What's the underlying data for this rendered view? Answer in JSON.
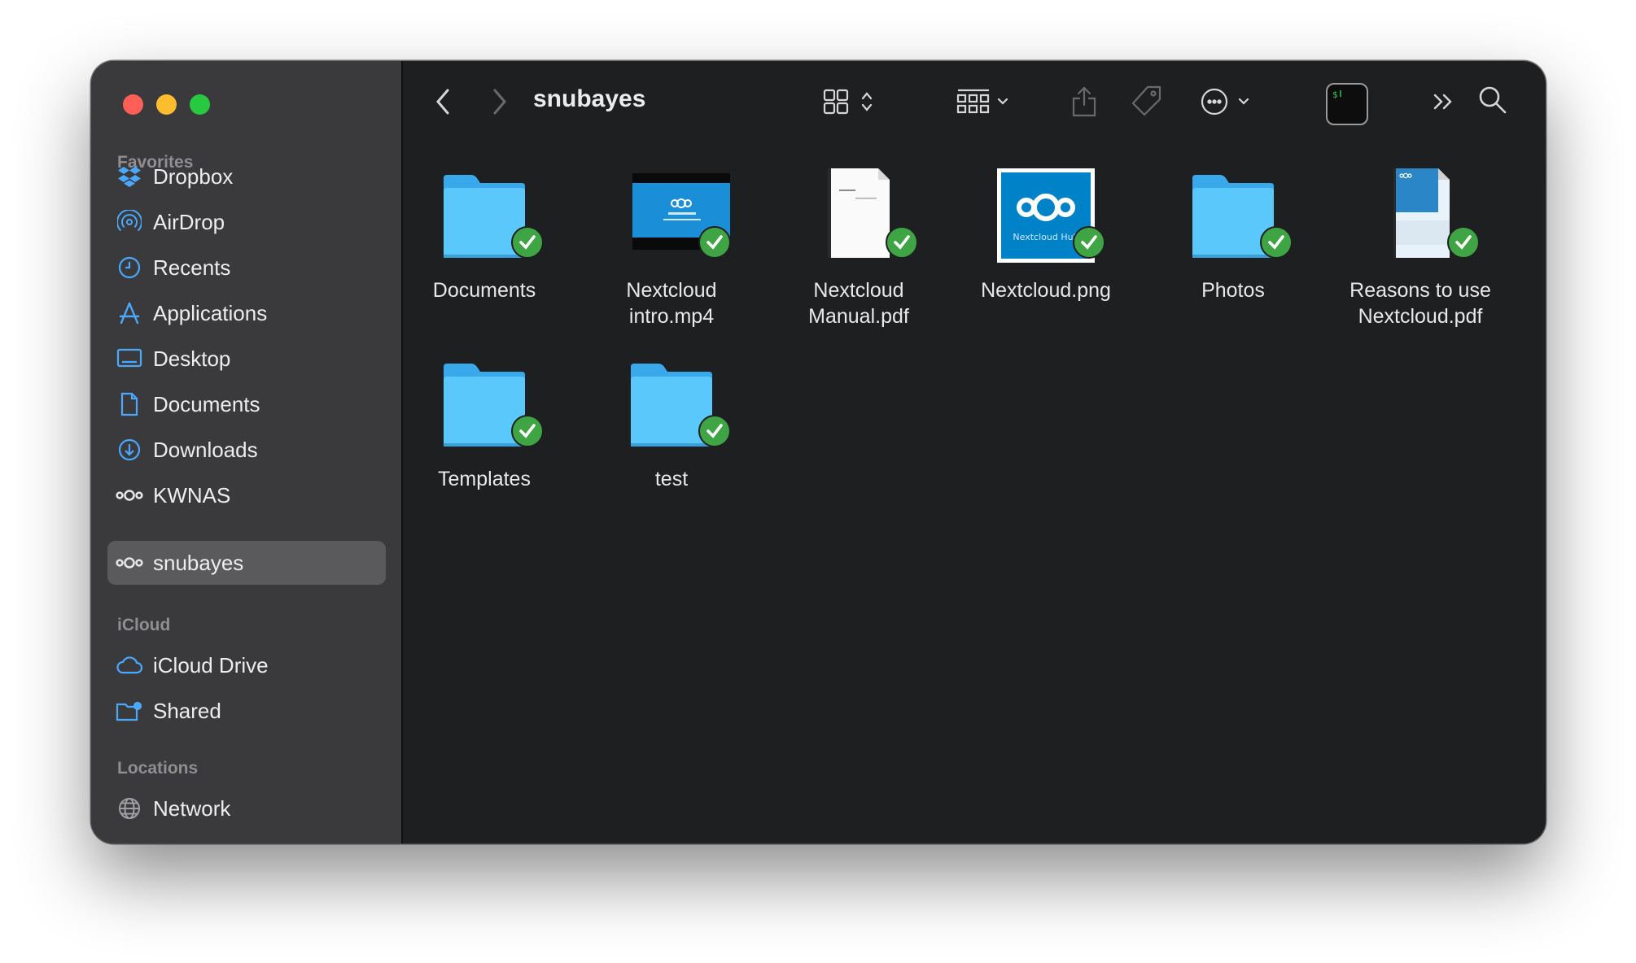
{
  "window": {
    "title": "snubayes"
  },
  "sidebar": {
    "favorites_title": "Favorites",
    "icloud_title": "iCloud",
    "locations_title": "Locations",
    "favorites": [
      {
        "label": "Dropbox",
        "icon": "dropbox-icon"
      },
      {
        "label": "AirDrop",
        "icon": "airdrop-icon"
      },
      {
        "label": "Recents",
        "icon": "clock-icon"
      },
      {
        "label": "Applications",
        "icon": "applications-icon"
      },
      {
        "label": "Desktop",
        "icon": "desktop-icon"
      },
      {
        "label": "Documents",
        "icon": "document-icon"
      },
      {
        "label": "Downloads",
        "icon": "download-icon"
      },
      {
        "label": "KWNAS",
        "icon": "nextcloud-icon"
      },
      {
        "label": "snubayes",
        "icon": "nextcloud-icon",
        "selected": true
      }
    ],
    "icloud": [
      {
        "label": "iCloud Drive",
        "icon": "cloud-icon"
      },
      {
        "label": "Shared",
        "icon": "shared-folder-icon"
      }
    ],
    "locations": [
      {
        "label": "Network",
        "icon": "globe-icon"
      }
    ]
  },
  "files": [
    {
      "name_line1": "Documents",
      "name_line2": "",
      "kind": "folder"
    },
    {
      "name_line1": "Nextcloud",
      "name_line2": "intro.mp4",
      "kind": "video"
    },
    {
      "name_line1": "Nextcloud",
      "name_line2": "Manual.pdf",
      "kind": "pdf"
    },
    {
      "name_line1": "Nextcloud.png",
      "name_line2": "",
      "kind": "image",
      "thumb_text": "Nextcloud Hub"
    },
    {
      "name_line1": "Photos",
      "name_line2": "",
      "kind": "folder"
    },
    {
      "name_line1": "Reasons to use",
      "name_line2": "Nextcloud.pdf",
      "kind": "pdf-cover"
    },
    {
      "name_line1": "Templates",
      "name_line2": "",
      "kind": "folder"
    },
    {
      "name_line1": "test",
      "name_line2": "",
      "kind": "folder"
    }
  ],
  "colors": {
    "folder": "#5ac8fa",
    "sync_badge": "#3fa544",
    "accent_icon": "#4aa8ff"
  }
}
